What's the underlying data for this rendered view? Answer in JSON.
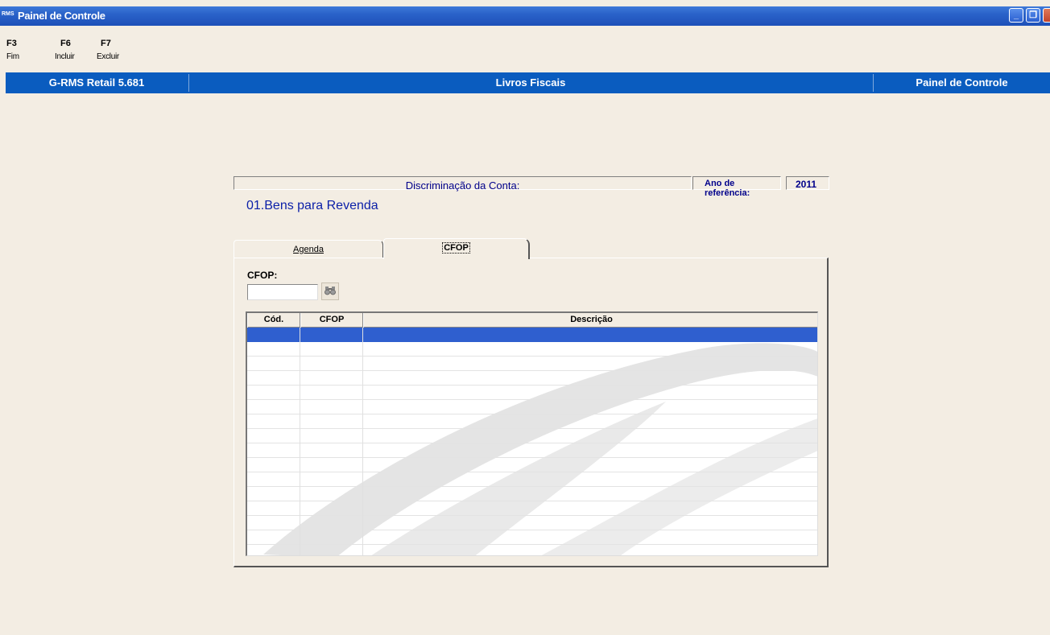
{
  "window": {
    "app_icon_text": "RMS",
    "title": "Painel de Controle",
    "minimize_glyph": "_",
    "restore_glyph": "❐",
    "close_glyph": ""
  },
  "toolbar": {
    "items": [
      {
        "key": "F3",
        "label": "Fim"
      },
      {
        "key": "F6",
        "label": "Incluir"
      },
      {
        "key": "F7",
        "label": "Excluir"
      }
    ]
  },
  "infobar": {
    "system": "G-RMS Retail 5.681",
    "module": "Livros Fiscais",
    "screen": "Painel de Controle"
  },
  "account": {
    "header_label": "Discriminação da Conta:",
    "year_label": "Ano de referência:",
    "year_value": "2011",
    "name": "01.Bens para Revenda"
  },
  "tabs": [
    {
      "label": "Agenda",
      "active": false
    },
    {
      "label": "CFOP",
      "active": true
    }
  ],
  "cfop_filter": {
    "label": "CFOP:",
    "value": "",
    "search_icon": "binoculars-icon"
  },
  "grid": {
    "columns": [
      "Cód.",
      "CFOP",
      "Descrição"
    ],
    "rows": [],
    "selected_row_color": "#2f5fcf"
  },
  "colors": {
    "titlebar": "#2a62c9",
    "infobar": "#0a5cbf",
    "background": "#f3ede3",
    "account_text": "#0b1fa8"
  }
}
